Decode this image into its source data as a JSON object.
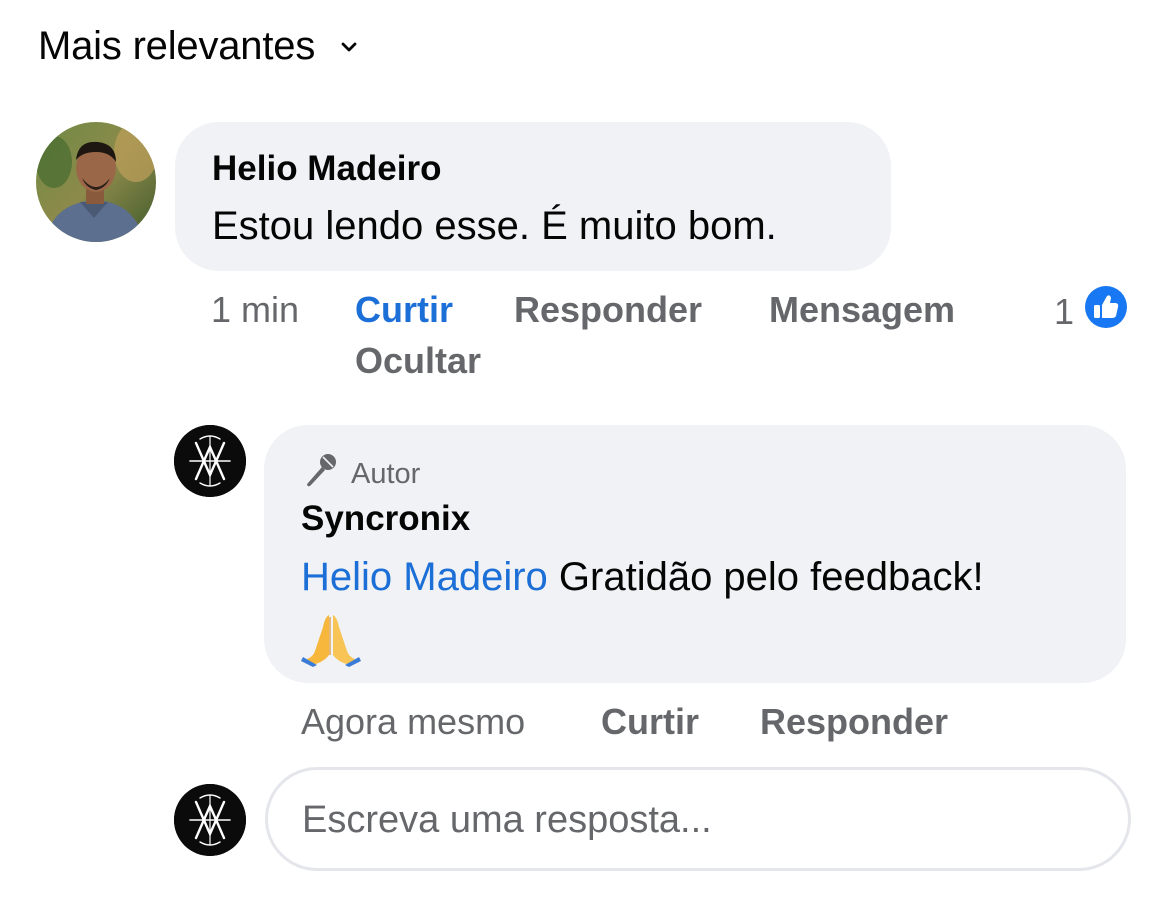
{
  "sort": {
    "label": "Mais relevantes",
    "icon": "chevron-down-icon"
  },
  "comment": {
    "author": "Helio Madeiro",
    "text": "Estou lendo esse. É muito bom.",
    "avatar_icon": "user-photo-avatar",
    "actions": {
      "time": "1 min",
      "like": "Curtir",
      "reply": "Responder",
      "message": "Mensagem",
      "hide": "Ocultar"
    },
    "reaction_count": "1",
    "reaction_icon": "like-reaction-icon",
    "like_color": "#1b6fd6"
  },
  "reply": {
    "badge": "Autor",
    "badge_icon": "microphone-icon",
    "author": "Syncronix",
    "mention": "Helio Madeiro",
    "text": " Gratidão pelo feedback!",
    "emoji": "🙏",
    "emoji_icon": "praying-hands-icon",
    "actions": {
      "time": "Agora mesmo",
      "like": "Curtir",
      "reply": "Responder"
    }
  },
  "reply_box": {
    "placeholder": "Escreva uma resposta...",
    "value": ""
  },
  "colors": {
    "bubble_bg": "#f0f2f5",
    "secondary_text": "#65676b",
    "accent_blue": "#1b6fd6"
  }
}
